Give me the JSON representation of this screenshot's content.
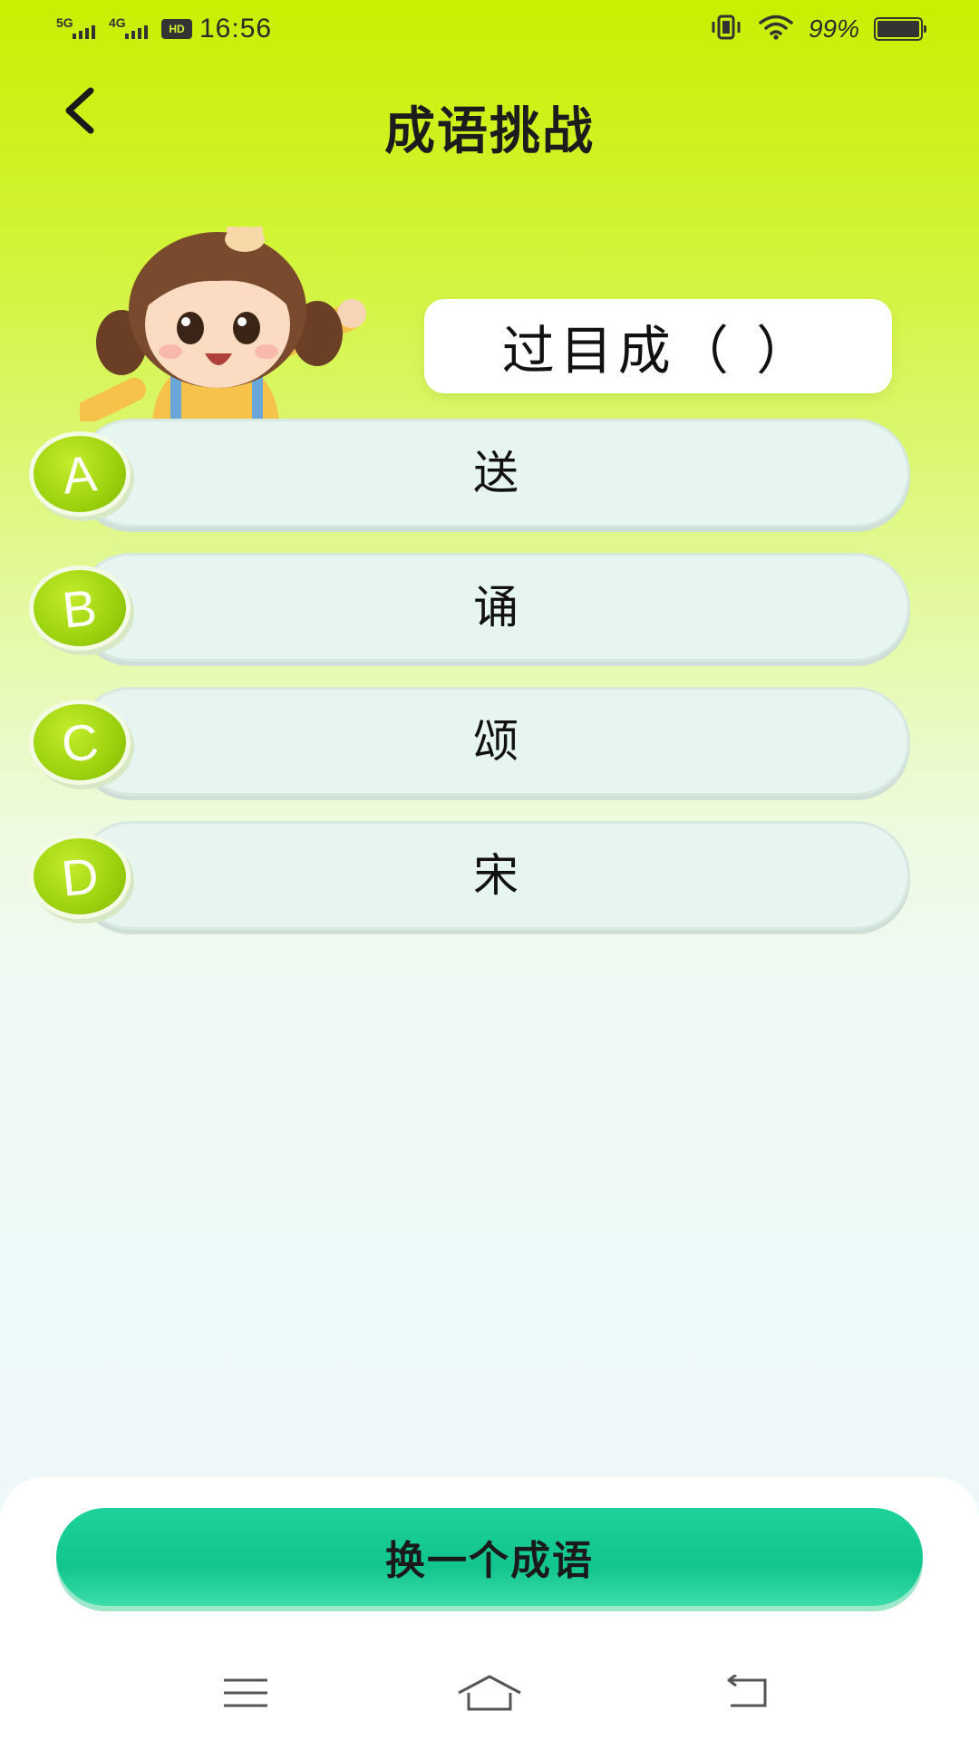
{
  "status_bar": {
    "signal_1": "5G",
    "signal_2": "4G",
    "hd_badge": "HD",
    "time": "16:56",
    "battery_percent": "99%",
    "battery_level": 0.99,
    "icons": [
      "vibrate-icon",
      "wifi-icon",
      "battery-icon"
    ]
  },
  "header": {
    "title": "成语挑战",
    "back_icon": "chevron-left-icon"
  },
  "mascot": {
    "icon": "cartoon-girl-mascot"
  },
  "question": {
    "text": "过目成（ ）"
  },
  "options": [
    {
      "letter": "A",
      "text": "送"
    },
    {
      "letter": "B",
      "text": "诵"
    },
    {
      "letter": "C",
      "text": "颂"
    },
    {
      "letter": "D",
      "text": "宋"
    }
  ],
  "footer": {
    "change_button_label": "换一个成语"
  },
  "nav_bar": {
    "items": [
      "menu-icon",
      "home-icon",
      "back-icon"
    ]
  },
  "colors": {
    "accent_green": "#9fd410",
    "button_teal": "#12c48e",
    "option_bg": "#e6f5ef",
    "top_gradient": "#c8f000"
  }
}
